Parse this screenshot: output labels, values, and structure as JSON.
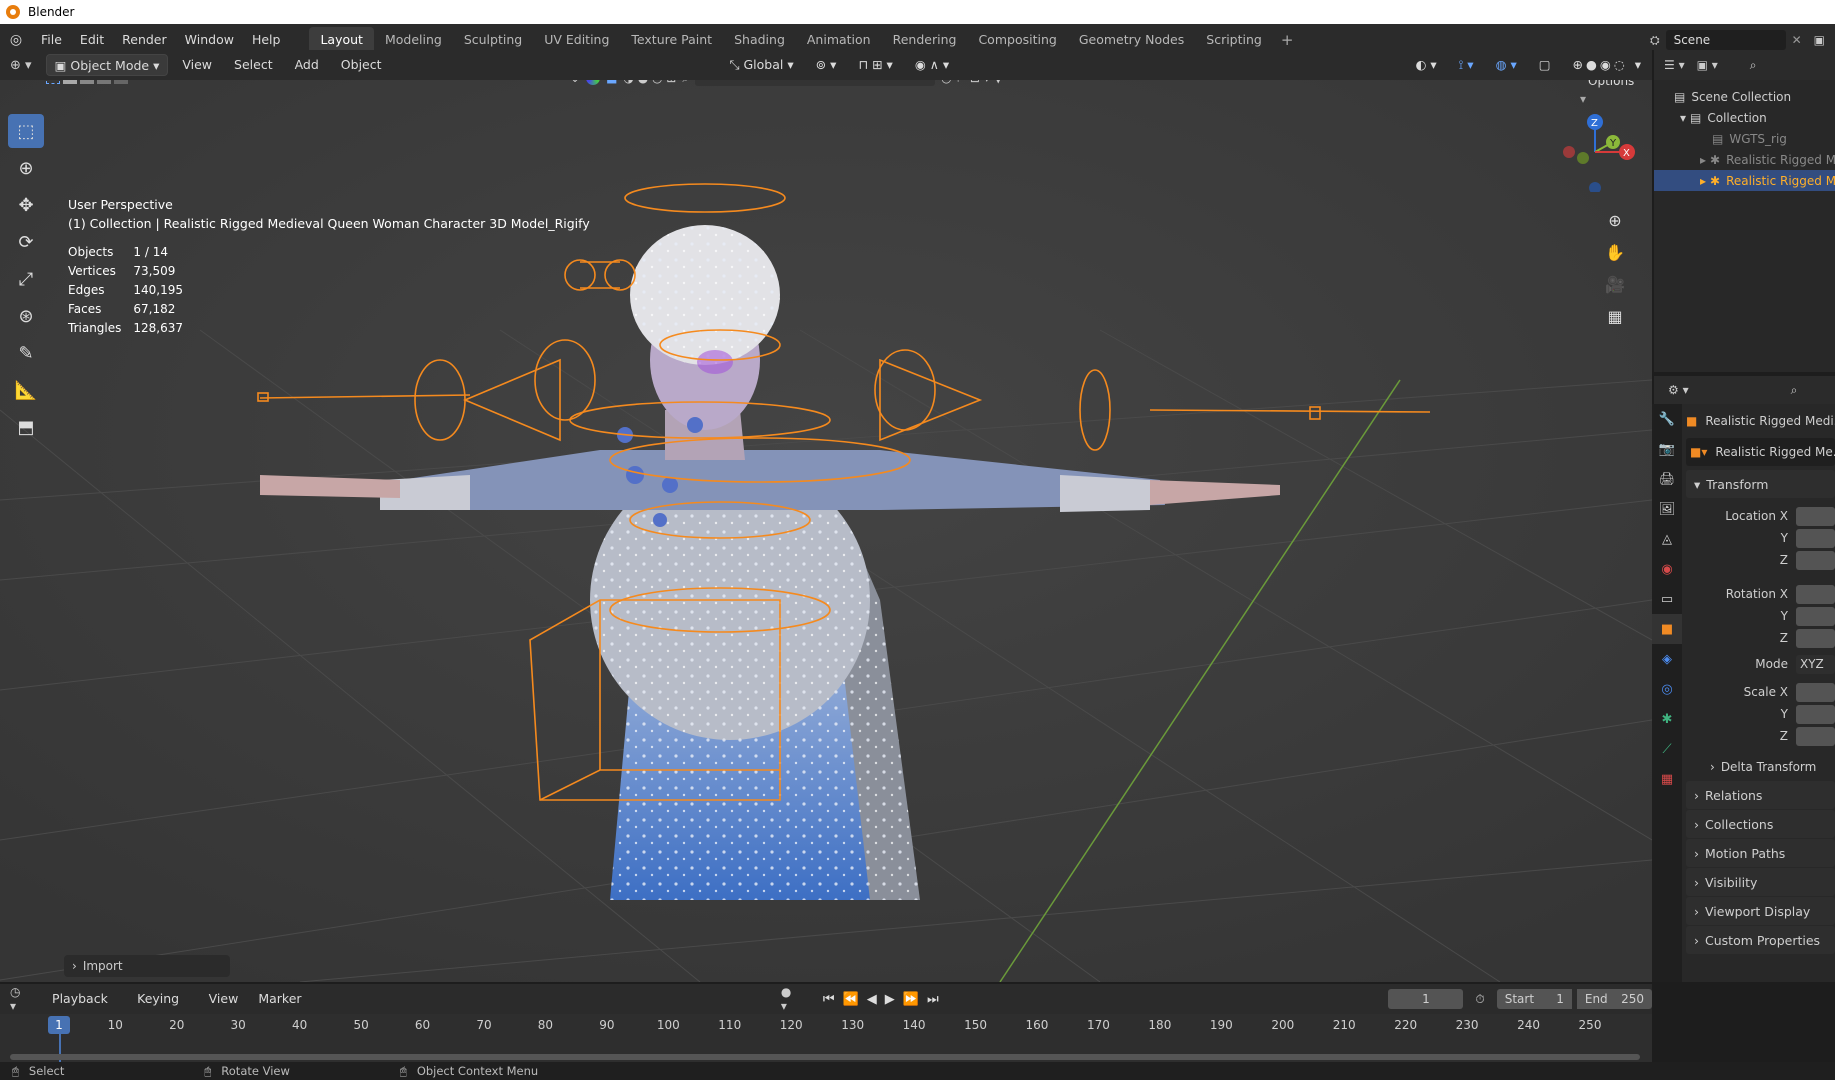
{
  "window": {
    "title": "Blender"
  },
  "menu": [
    "File",
    "Edit",
    "Render",
    "Window",
    "Help"
  ],
  "workspaces": {
    "active": "Layout",
    "tabs": [
      "Layout",
      "Modeling",
      "Sculpting",
      "UV Editing",
      "Texture Paint",
      "Shading",
      "Animation",
      "Rendering",
      "Compositing",
      "Geometry Nodes",
      "Scripting"
    ]
  },
  "scene": {
    "name": "Scene"
  },
  "viewport_header": {
    "mode": "Object Mode",
    "menus": [
      "View",
      "Select",
      "Add",
      "Object"
    ],
    "transform_orientation": "Global",
    "options_label": "Options"
  },
  "viewport": {
    "perspective": "User Perspective",
    "collection_line": "(1) Collection | Realistic Rigged Medieval Queen Woman Character 3D Model_Rigify",
    "stats": [
      {
        "label": "Objects",
        "value": "1 / 14"
      },
      {
        "label": "Vertices",
        "value": "73,509"
      },
      {
        "label": "Edges",
        "value": "140,195"
      },
      {
        "label": "Faces",
        "value": "67,182"
      },
      {
        "label": "Triangles",
        "value": "128,637"
      }
    ],
    "import_panel": "Import",
    "gizmo_axes": [
      "Z",
      "Y",
      "X"
    ]
  },
  "outliner": {
    "items": [
      {
        "label": "Scene Collection",
        "depth": 0,
        "selected": false,
        "dim": false
      },
      {
        "label": "Collection",
        "depth": 1,
        "selected": false,
        "dim": false
      },
      {
        "label": "WGTS_rig",
        "depth": 2,
        "selected": false,
        "dim": true
      },
      {
        "label": "Realistic Rigged Me",
        "depth": 2,
        "selected": false,
        "dim": true
      },
      {
        "label": "Realistic Rigged Me",
        "depth": 2,
        "selected": true,
        "dim": false
      }
    ]
  },
  "properties": {
    "object_name": "Realistic Rigged Medi...",
    "data_name": "Realistic Rigged Me...",
    "transform_header": "Transform",
    "location_labels": [
      "Location X",
      "Y",
      "Z"
    ],
    "rotation_labels": [
      "Rotation X",
      "Y",
      "Z"
    ],
    "mode_label": "Mode",
    "mode_value": "XYZ",
    "scale_labels": [
      "Scale X",
      "Y",
      "Z"
    ],
    "delta_transform": "Delta Transform",
    "panels": [
      "Relations",
      "Collections",
      "Motion Paths",
      "Visibility",
      "Viewport Display",
      "Custom Properties"
    ]
  },
  "timeline": {
    "menus": [
      "Playback",
      "Keying",
      "View",
      "Marker"
    ],
    "current_frame": "1",
    "start_label": "Start",
    "start_value": "1",
    "end_label": "End",
    "end_value": "250",
    "ticks": [
      "10",
      "20",
      "30",
      "40",
      "50",
      "60",
      "70",
      "80",
      "90",
      "100",
      "110",
      "120",
      "130",
      "140",
      "150",
      "160",
      "170",
      "180",
      "190",
      "200",
      "210",
      "220",
      "230",
      "240",
      "250"
    ],
    "playhead": "1"
  },
  "statusbar": {
    "items": [
      "Select",
      "Rotate View",
      "Object Context Menu"
    ]
  }
}
